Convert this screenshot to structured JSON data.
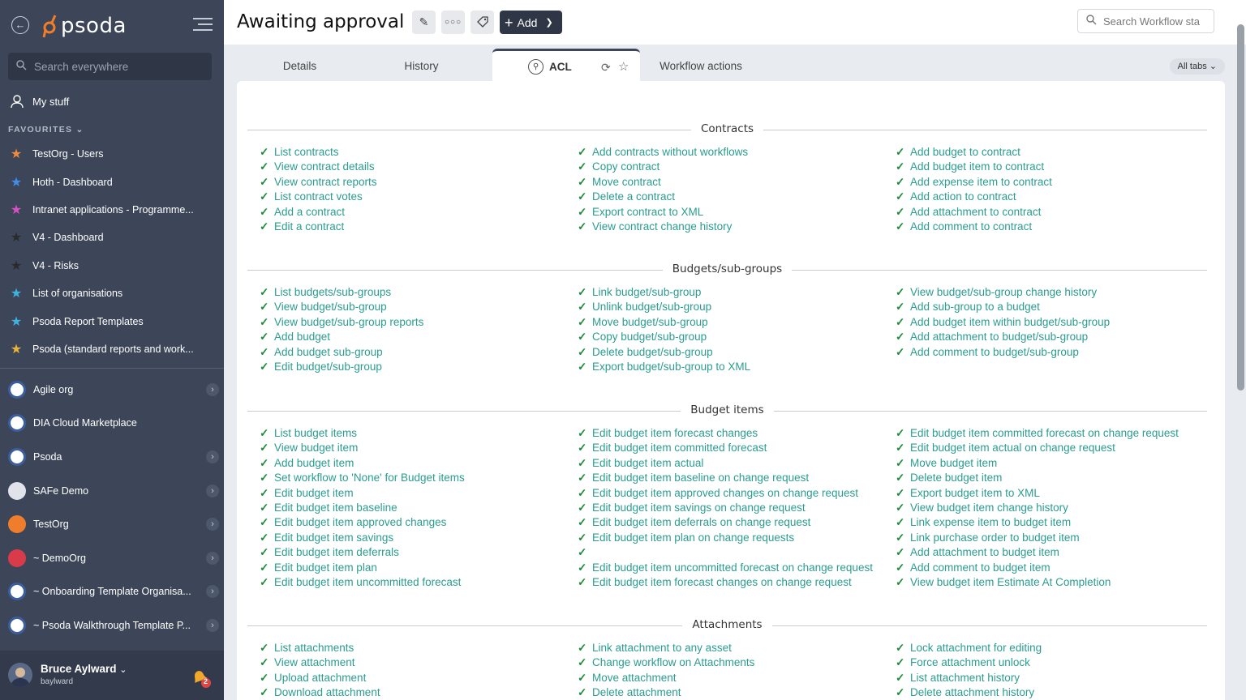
{
  "sidebar": {
    "logo_text": "psoda",
    "search_placeholder": "Search everywhere",
    "my_stuff": "My stuff",
    "favourites_label": "FAVOURITES",
    "favourites": [
      {
        "label": "TestOrg - Users",
        "color": "#f08a3c"
      },
      {
        "label": "Hoth - Dashboard",
        "color": "#3f8ee8"
      },
      {
        "label": "Intranet applications - Programme...",
        "color": "#d94fc7"
      },
      {
        "label": "V4 - Dashboard",
        "color": "#2a2a2a"
      },
      {
        "label": "V4 - Risks",
        "color": "#2a2a2a"
      },
      {
        "label": "List of organisations",
        "color": "#3fb3e0"
      },
      {
        "label": "Psoda Report Templates",
        "color": "#3fb3e0"
      },
      {
        "label": "Psoda (standard reports and work...",
        "color": "#e8b43a"
      }
    ],
    "organisations": [
      {
        "label": "Agile org",
        "has_children": true,
        "icon_color": "#3b5f9e"
      },
      {
        "label": "DIA Cloud Marketplace",
        "has_children": false,
        "icon_color": "#3b5f9e"
      },
      {
        "label": "Psoda",
        "has_children": true,
        "icon_color": "#3b5f9e"
      },
      {
        "label": "SAFe Demo",
        "has_children": true,
        "icon_color": "#e0e4ea"
      },
      {
        "label": "TestOrg",
        "has_children": true,
        "icon_color": "#f07d2c"
      },
      {
        "label": "~ DemoOrg",
        "has_children": true,
        "icon_color": "#d93b4a"
      },
      {
        "label": "~ Onboarding Template Organisa...",
        "has_children": true,
        "icon_color": "#3b5f9e"
      },
      {
        "label": "~ Psoda Walkthrough Template P...",
        "has_children": true,
        "icon_color": "#3b5f9e"
      }
    ],
    "user": {
      "name": "Bruce Aylward",
      "login": "baylward",
      "notifications": "2"
    }
  },
  "header": {
    "title": "Awaiting approval",
    "add_label": "Add",
    "search_placeholder": "Search Workflow sta"
  },
  "tabs": {
    "items": [
      "Details",
      "History",
      "ACL",
      "Workflow actions"
    ],
    "all_tabs": "All tabs"
  },
  "sections": [
    {
      "title": "Contracts",
      "columns": [
        [
          "List contracts",
          "View contract details",
          "View contract reports",
          "List contract votes",
          "Add a contract",
          "Edit a contract"
        ],
        [
          "Add contracts without workflows",
          "Copy contract",
          "Move contract",
          "Delete a contract",
          "Export contract to XML",
          "View contract change history"
        ],
        [
          "Add budget to contract",
          "Add budget item to contract",
          "Add expense item to contract",
          "Add action to contract",
          "Add attachment to contract",
          "Add comment to contract"
        ]
      ]
    },
    {
      "title": "Budgets/sub-groups",
      "columns": [
        [
          "List budgets/sub-groups",
          "View budget/sub-group",
          "View budget/sub-group reports",
          "Add budget",
          "Add budget sub-group",
          "Edit budget/sub-group"
        ],
        [
          "Link budget/sub-group",
          "Unlink budget/sub-group",
          "Move budget/sub-group",
          "Copy budget/sub-group",
          "Delete budget/sub-group",
          "Export budget/sub-group to XML"
        ],
        [
          "View budget/sub-group change history",
          "Add sub-group to a budget",
          "Add budget item within budget/sub-group",
          "Add attachment to budget/sub-group",
          "Add comment to budget/sub-group"
        ]
      ]
    },
    {
      "title": "Budget items",
      "columns": [
        [
          "List budget items",
          "View budget item",
          "Add budget item",
          "Set workflow to 'None' for Budget items",
          "Edit budget item",
          "Edit budget item baseline",
          "Edit budget item approved changes",
          "Edit budget item savings",
          "Edit budget item deferrals",
          "Edit budget item plan",
          "Edit budget item uncommitted forecast"
        ],
        [
          "Edit budget item forecast changes",
          "Edit budget item committed forecast",
          "Edit budget item actual",
          "Edit budget item baseline on change request",
          "Edit budget item approved changes on change request",
          "Edit budget item savings on change request",
          "Edit budget item deferrals on change request",
          "Edit budget item plan on change requests",
          "",
          "Edit budget item uncommitted forecast on change request",
          "Edit budget item forecast changes on change request"
        ],
        [
          "Edit budget item committed forecast on change request",
          "Edit budget item actual on change request",
          "Move budget item",
          "Delete budget item",
          "Export budget item to XML",
          "View budget item change history",
          "Link expense item to budget item",
          "Link purchase order to budget item",
          "Add attachment to budget item",
          "Add comment to budget item",
          "View budget item Estimate At Completion"
        ]
      ]
    },
    {
      "title": "Attachments",
      "columns": [
        [
          "List attachments",
          "View attachment",
          "Upload attachment",
          "Download attachment"
        ],
        [
          "Link attachment to any asset",
          "Change workflow on Attachments",
          "Move attachment",
          "Delete attachment"
        ],
        [
          "Lock attachment for editing",
          "Force attachment unlock",
          "List attachment history",
          "Delete attachment history"
        ]
      ]
    }
  ]
}
